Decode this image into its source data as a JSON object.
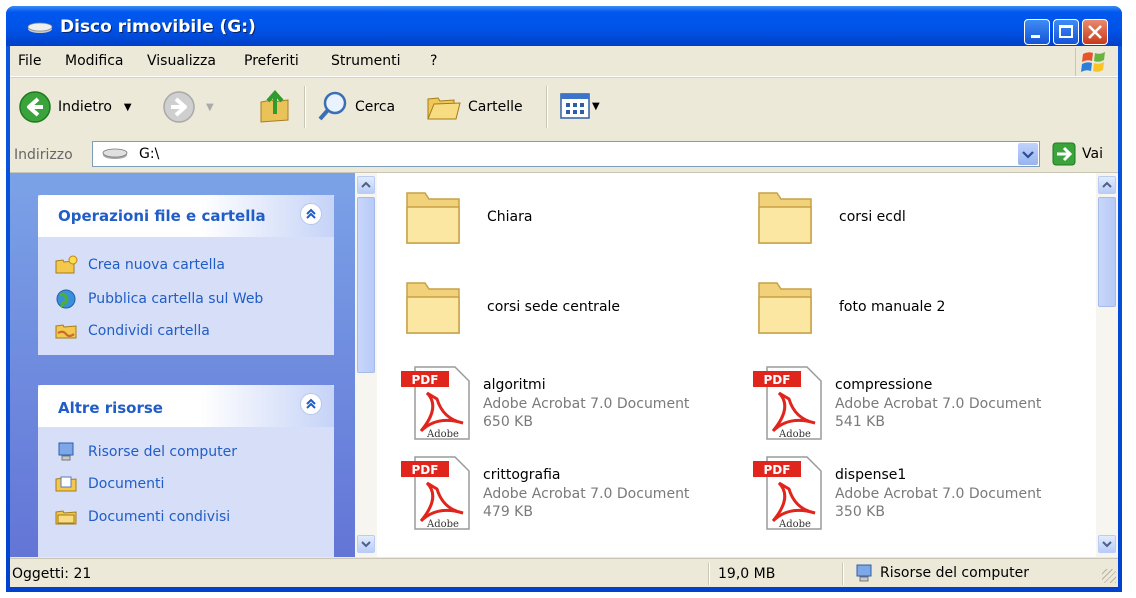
{
  "window": {
    "title": "Disco rimovibile (G:)",
    "icon": "drive-icon"
  },
  "menu": [
    "File",
    "Modifica",
    "Visualizza",
    "Preferiti",
    "Strumenti",
    "?"
  ],
  "toolbar": {
    "back_label": "Indietro",
    "search_label": "Cerca",
    "folders_label": "Cartelle"
  },
  "address": {
    "label": "Indirizzo",
    "value": "G:\\",
    "go_label": "Vai"
  },
  "tasks": {
    "file_panel": {
      "title": "Operazioni file e cartella",
      "items": [
        "Crea nuova cartella",
        "Pubblica cartella sul Web",
        "Condividi cartella"
      ]
    },
    "other_panel": {
      "title": "Altre risorse",
      "items": [
        "Risorse del computer",
        "Documenti",
        "Documenti condivisi"
      ]
    }
  },
  "files": [
    {
      "name": "Chiara",
      "type": "folder"
    },
    {
      "name": "corsi ecdl",
      "type": "folder"
    },
    {
      "name": "corsi sede centrale",
      "type": "folder"
    },
    {
      "name": "foto manuale 2",
      "type": "folder"
    },
    {
      "name": "algoritmi",
      "type": "pdf",
      "kind": "Adobe Acrobat 7.0 Document",
      "size": "650 KB"
    },
    {
      "name": "compressione",
      "type": "pdf",
      "kind": "Adobe Acrobat 7.0 Document",
      "size": "541 KB"
    },
    {
      "name": "crittografia",
      "type": "pdf",
      "kind": "Adobe Acrobat 7.0 Document",
      "size": "479 KB"
    },
    {
      "name": "dispense1",
      "type": "pdf",
      "kind": "Adobe Acrobat 7.0 Document",
      "size": "350 KB"
    }
  ],
  "pdf_icon": {
    "badge": "PDF",
    "brand": "Adobe"
  },
  "status": {
    "objects": "Oggetti: 21",
    "size": "19,0 MB",
    "location": "Risorse del computer"
  }
}
